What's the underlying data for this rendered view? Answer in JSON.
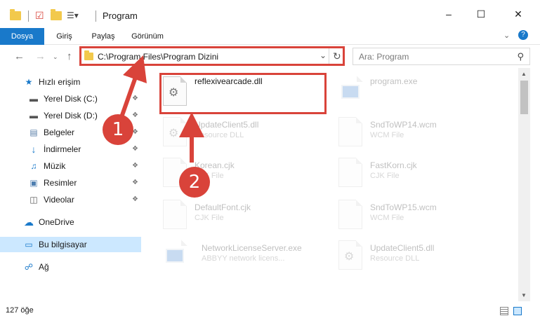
{
  "window": {
    "title": "Program",
    "controls": {
      "minimize": "–",
      "maximize": "☐",
      "close": "✕"
    }
  },
  "ribbon": {
    "tabs": [
      "Dosya",
      "Giriş",
      "Paylaş",
      "Görünüm"
    ]
  },
  "address": {
    "path": "C:\\Program Files\\Program Dizini",
    "search_placeholder": "Ara: Program"
  },
  "sidebar": {
    "quick_access": "Hızlı erişim",
    "items": [
      {
        "label": "Yerel Disk (C:)",
        "icon": "drive-icon",
        "pinned": true
      },
      {
        "label": "Yerel Disk (D:)",
        "icon": "drive-icon",
        "pinned": true
      },
      {
        "label": "Belgeler",
        "icon": "documents-icon",
        "pinned": true
      },
      {
        "label": "İndirmeler",
        "icon": "download-icon",
        "pinned": true
      },
      {
        "label": "Müzik",
        "icon": "music-icon",
        "pinned": true
      },
      {
        "label": "Resimler",
        "icon": "pictures-icon",
        "pinned": true
      },
      {
        "label": "Videolar",
        "icon": "videos-icon",
        "pinned": true
      }
    ],
    "onedrive": "OneDrive",
    "this_pc": "Bu bilgisayar",
    "network": "Ağ"
  },
  "files": [
    {
      "name": "reflexivearcade.dll",
      "type": "",
      "highlighted": true
    },
    {
      "name": "program.exe",
      "type": ""
    },
    {
      "name": "UpdateClient5.dll",
      "type": "Resource DLL"
    },
    {
      "name": "SndToWP14.wcm",
      "type": "WCM File"
    },
    {
      "name": "Korean.cjk",
      "type": "CJK File"
    },
    {
      "name": "FastKorn.cjk",
      "type": "CJK File"
    },
    {
      "name": "DefaultFont.cjk",
      "type": "CJK File"
    },
    {
      "name": "SndToWP15.wcm",
      "type": "WCM File"
    },
    {
      "name": "NetworkLicenseServer.exe",
      "type": "ABBYY network licens..."
    },
    {
      "name": "UpdateClient5.dll",
      "type": "Resource DLL"
    }
  ],
  "status": {
    "count": "127 öğe"
  },
  "annotations": {
    "step1": "1",
    "step2": "2",
    "color": "#d9433a"
  },
  "colors": {
    "accent": "#1979ca",
    "selection": "#cce8ff"
  }
}
